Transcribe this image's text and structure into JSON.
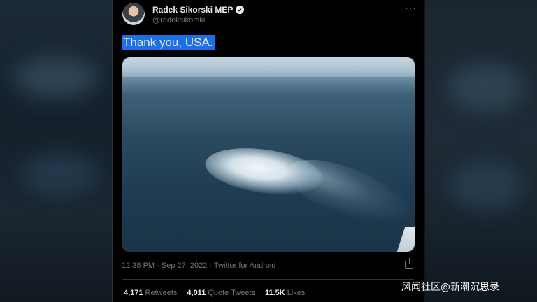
{
  "tweet": {
    "author_name": "Radek Sikorski MEP",
    "handle": "@radeksikorski",
    "text": "Thank you, USA.",
    "more_icon": "more-horizontal-icon",
    "verified_icon": "verified-badge-icon",
    "meta": "12:38 PM · Sep 27, 2022 · Twitter for Android",
    "stats": {
      "retweets_count": "4,171",
      "retweets_label": "Retweets",
      "quote_count": "4,011",
      "quote_label": "Quote Tweets",
      "likes_count": "11.5K",
      "likes_label": "Likes"
    }
  },
  "watermark": "风闻社区@新潮沉思录",
  "colors": {
    "background": "#000000",
    "text": "#e7e9ea",
    "secondary_text": "#71767b",
    "selection_highlight": "#1d6fe6"
  }
}
